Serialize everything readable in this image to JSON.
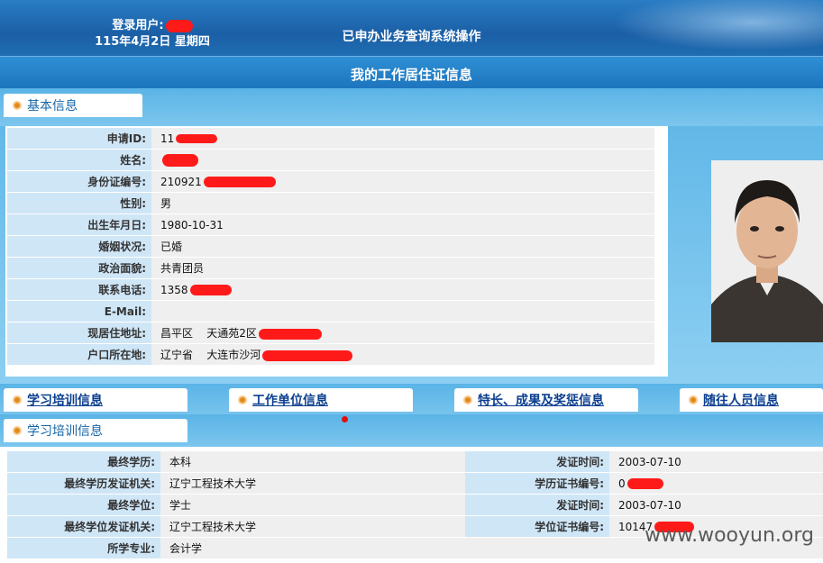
{
  "header": {
    "login_label": "登录用户:",
    "date": "115年4月2日 星期四",
    "system_title": "已申办业务查询系统操作",
    "page_title": "我的工作居住证信息"
  },
  "basic_tab": "基本信息",
  "basic": [
    {
      "label": "申请ID:",
      "value": "11"
    },
    {
      "label": "姓名:",
      "value": ""
    },
    {
      "label": "身份证编号:",
      "value": "210921"
    },
    {
      "label": "性别:",
      "value": "男"
    },
    {
      "label": "出生年月日:",
      "value": "1980-10-31"
    },
    {
      "label": "婚姻状况:",
      "value": "已婚"
    },
    {
      "label": "政治面貌:",
      "value": "共青团员"
    },
    {
      "label": "联系电话:",
      "value": "1358"
    },
    {
      "label": "E-Mail:",
      "value": ""
    },
    {
      "label": "现居住地址:",
      "value": "昌平区    天通苑2区"
    },
    {
      "label": "户口所在地:",
      "value": "辽宁省    大连市沙河"
    }
  ],
  "tabs": [
    "学习培训信息",
    "工作单位信息",
    "特长、成果及奖惩信息",
    "随往人员信息"
  ],
  "study_tab": "学习培训信息",
  "study": [
    {
      "k1": "最终学历:",
      "v1": "本科",
      "k2": "发证时间:",
      "v2": "2003-07-10"
    },
    {
      "k1": "最终学历发证机关:",
      "v1": "辽宁工程技术大学",
      "k2": "学历证书编号:",
      "v2": "0"
    },
    {
      "k1": "最终学位:",
      "v1": "学士",
      "k2": "发证时间:",
      "v2": "2003-07-10"
    },
    {
      "k1": "最终学位发证机关:",
      "v1": "辽宁工程技术大学",
      "k2": "学位证书编号:",
      "v2": "10147"
    },
    {
      "k1": "所学专业:",
      "v1": "会计学",
      "k2": "",
      "v2": ""
    }
  ],
  "watermark": "www.wooyun.org",
  "colors": {
    "accent": "#1c74bd",
    "label_bg": "#cfe6f7",
    "value_bg": "#efefef",
    "redaction": "#ff1a1a"
  }
}
